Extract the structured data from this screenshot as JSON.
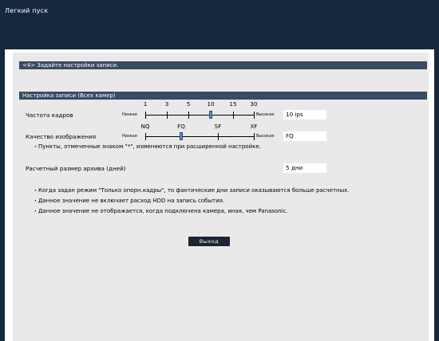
{
  "window": {
    "title": "Легкий пуск"
  },
  "step": {
    "header": "<4> Задайте настройки записи."
  },
  "section": {
    "header": "Настройка записи (Всех камер)"
  },
  "frame_rate": {
    "label": "Частота кадров",
    "scale_numbers": [
      "1",
      "3",
      "5",
      "10",
      "15",
      "30"
    ],
    "low_label": "Низкая",
    "high_label": "Высокая",
    "value": "10 ips"
  },
  "quality": {
    "label": "Качество изображения",
    "scale_labels": [
      "NQ",
      "FQ",
      "SF",
      "XF"
    ],
    "low_label": "Низкая",
    "high_label": "Высокая",
    "value": "FQ"
  },
  "note_advanced": "・Пункты, отмеченные знаком \"*\", изменяются при расширенной настройке.",
  "archive": {
    "label": "Расчетный размер архива (дней)",
    "value": "5 дни"
  },
  "notes": [
    "・Когда задан режим \"Только опорн.кадры\", то фактические дни записи оказываются больше расчетных.",
    "・Данное значение не включает расход HDD на запись события.",
    "・Данное значение не отображается, когда подключена камера, иная, чем Panasonic."
  ],
  "exit_button": {
    "label": "Выход"
  }
}
